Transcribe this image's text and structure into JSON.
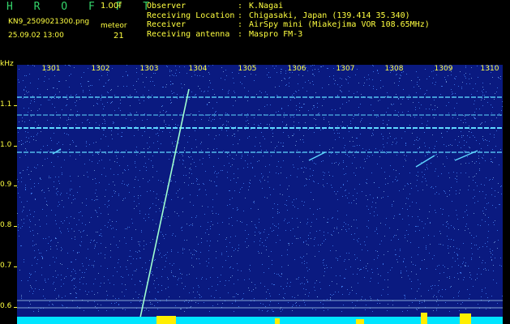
{
  "header": {
    "logo": "H R O F F T",
    "version": "1.00f",
    "filename": "KN9_2509021300.png",
    "datetime": "25.09.02 13:00",
    "meteor_label": "meteor",
    "meteor_count": "21",
    "info": [
      {
        "label": "Observer",
        "value": "K.Nagai"
      },
      {
        "label": "Receiving Location",
        "value": "Chigasaki, Japan (139.414 35.340)"
      },
      {
        "label": "Receiver",
        "value": "AirSpy mini (Miakejima VOR 108.65MHz)"
      },
      {
        "label": "Receiving antenna",
        "value": "Maspro FM-3"
      }
    ]
  },
  "axis": {
    "y_unit": "kHz",
    "y_ticks": [
      "1.1",
      "1.0",
      "0.9",
      "0.8",
      "0.7",
      "0.6"
    ],
    "x_ticks": [
      "1301",
      "1302",
      "1303",
      "1304",
      "1305",
      "1306",
      "1307",
      "1308",
      "1309",
      "1310"
    ]
  },
  "colors": {
    "background": "#000000",
    "label": "#ffff40",
    "logo": "#34d36a",
    "spectrogram_bg": "#0a1a80",
    "noise": "#4a8cff",
    "trail": "#9fffd0",
    "carrier": "#5fd8ff",
    "baseline": "#00e5ff",
    "burst": "#ffee00"
  }
}
